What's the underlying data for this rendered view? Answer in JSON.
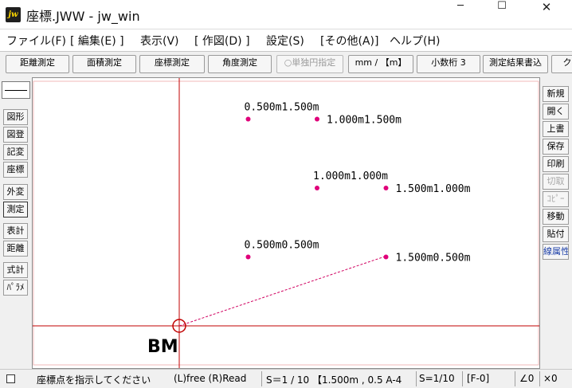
{
  "window": {
    "icon_text": "jw",
    "title": "座標.JWW - jw_win",
    "minimize": "─",
    "maximize": "☐",
    "close": "✕"
  },
  "menu": [
    "ファイル(F)",
    "[ 編集(E) ]",
    "表示(V)",
    "[ 作図(D) ]",
    "設定(S)",
    "[その他(A)]",
    "ヘルプ(H)"
  ],
  "toolbar": [
    {
      "label": "距離測定",
      "enabled": true
    },
    {
      "label": "面積測定",
      "enabled": true
    },
    {
      "label": "座標測定",
      "enabled": true
    },
    {
      "label": "角度測定",
      "enabled": true
    },
    {
      "label": "○単独円指定",
      "enabled": false
    },
    {
      "label": "mm / 【m】",
      "enabled": true
    },
    {
      "label": "小数桁 3",
      "enabled": true
    },
    {
      "label": "測定結果書込",
      "enabled": true
    },
    {
      "label": "ク",
      "enabled": true
    }
  ],
  "left_tools": [
    "図形",
    "図登",
    "記変",
    "座標",
    "外変",
    "測定",
    "表計",
    "距離",
    "式計",
    "ﾊﾟﾗﾒ"
  ],
  "active_left_tool": "測定",
  "right_tools": [
    {
      "label": "新規",
      "enabled": true
    },
    {
      "label": "開く",
      "enabled": true
    },
    {
      "label": "上書",
      "enabled": true
    },
    {
      "label": "保存",
      "enabled": true
    },
    {
      "label": "印刷",
      "enabled": true
    },
    {
      "label": "切取",
      "enabled": false
    },
    {
      "label": "ｺﾋﾟｰ",
      "enabled": false
    },
    {
      "label": "移動",
      "enabled": true
    },
    {
      "label": "貼付",
      "enabled": true
    },
    {
      "label": "線属性",
      "enabled": true,
      "accent": true
    }
  ],
  "drawing": {
    "benchmark_label": "BM",
    "points": [
      {
        "label": "0.500m1.500m",
        "x": 0.5,
        "y": 1.5
      },
      {
        "label": "1.000m1.500m",
        "x": 1.0,
        "y": 1.5
      },
      {
        "label": "1.000m1.000m",
        "x": 1.0,
        "y": 1.0
      },
      {
        "label": "1.500m1.000m",
        "x": 1.5,
        "y": 1.0
      },
      {
        "label": "0.500m0.500m",
        "x": 0.5,
        "y": 0.5
      },
      {
        "label": "1.500m0.500m",
        "x": 1.5,
        "y": 0.5
      }
    ],
    "colors": {
      "axis": "#c00000",
      "point": "#e0007a",
      "guide": "#d00060",
      "frame": "#f2b8b8"
    }
  },
  "status": {
    "message": "座標点を指示してください",
    "mouse": "(L)free  (R)Read",
    "scale": "S＝1 / 10 【1.500m , 0.5 A-4",
    "scale2": "S=1/10",
    "layer": "[F-0]",
    "angle": "∠0",
    "zoom": "×0"
  }
}
